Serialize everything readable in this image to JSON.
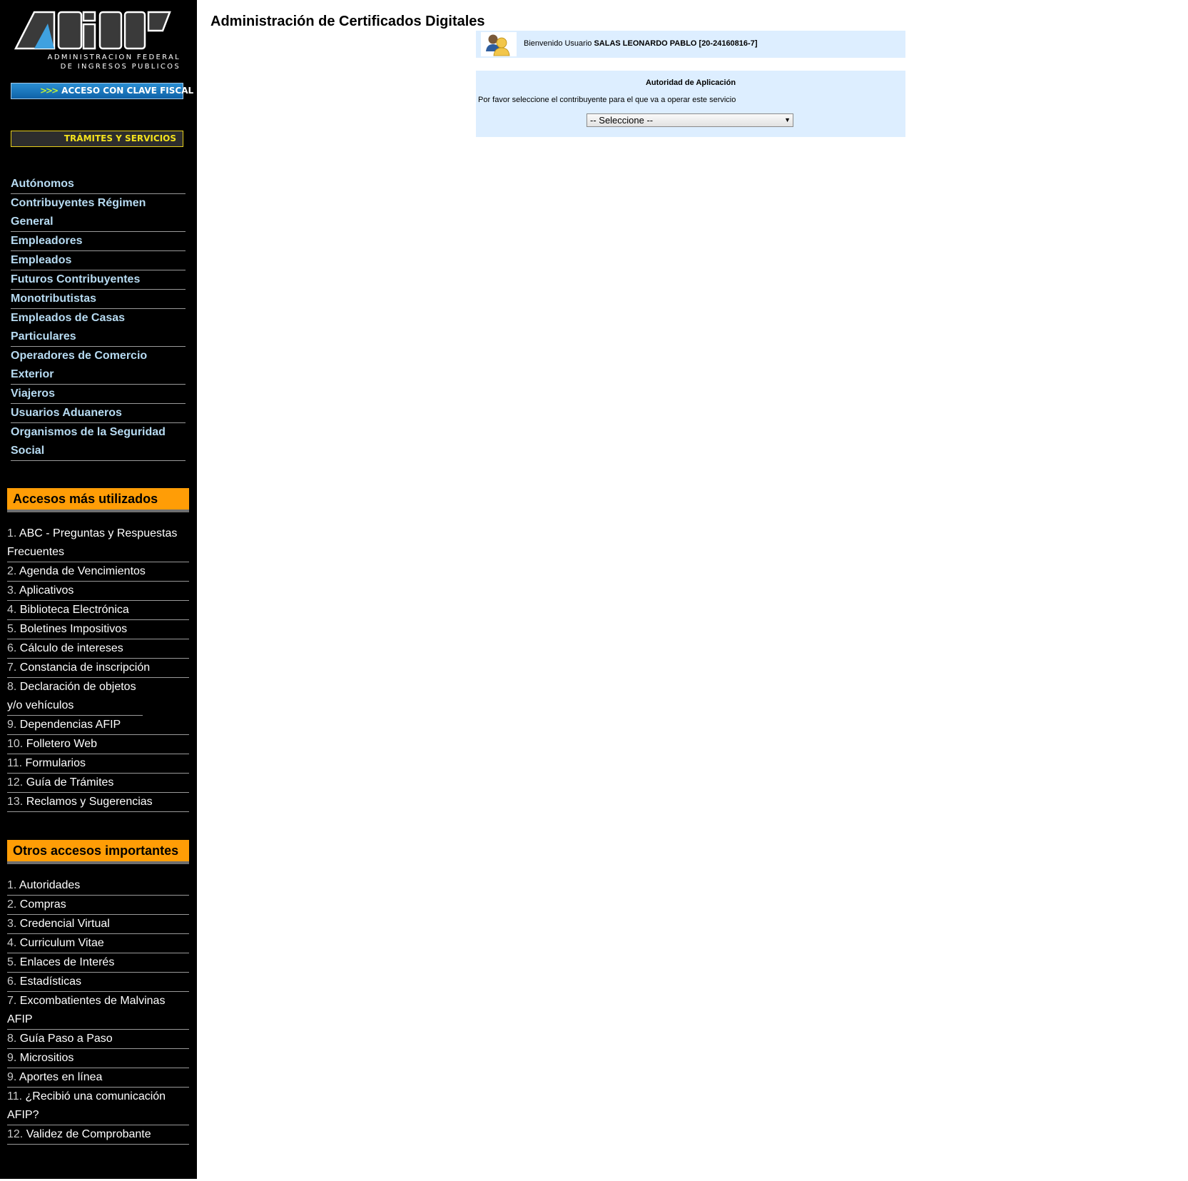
{
  "brand": {
    "logo_text": "AFIP",
    "subtitle_line1": "ADMINISTRACION FEDERAL",
    "subtitle_line2": "DE INGRESOS PUBLICOS"
  },
  "sidebar": {
    "clave_fiscal_label": "ACCESO CON CLAVE FISCAL",
    "clave_fiscal_chevrons": ">>>",
    "tramites_label": "TRÁMITES Y SERVICIOS",
    "nav": [
      "Autónomos",
      "Contribuyentes Régimen General",
      "Empleadores",
      "Empleados",
      "Futuros Contribuyentes",
      "Monotributistas",
      "Empleados de Casas Particulares",
      "Operadores de Comercio Exterior",
      "Viajeros",
      "Usuarios Aduaneros",
      "Organismos de la Seguridad Social"
    ],
    "accesos_title": "Accesos más utilizados",
    "accesos": [
      {
        "num": "1.",
        "label": "ABC - Preguntas y Respuestas Frecuentes"
      },
      {
        "num": "2.",
        "label": "Agenda de Vencimientos"
      },
      {
        "num": "3.",
        "label": "Aplicativos"
      },
      {
        "num": "4.",
        "label": "Biblioteca Electrónica"
      },
      {
        "num": "5.",
        "label": "Boletines Impositivos"
      },
      {
        "num": "6.",
        "label": "Cálculo de intereses"
      },
      {
        "num": "7.",
        "label": "Constancia de inscripción"
      },
      {
        "num": "8.",
        "label": "Declaración de objetos y/o vehículos"
      },
      {
        "num": "9.",
        "label": "Dependencias AFIP"
      },
      {
        "num": "10.",
        "label": "Folletero Web"
      },
      {
        "num": "11.",
        "label": "Formularios"
      },
      {
        "num": "12.",
        "label": "Guía de Trámites"
      },
      {
        "num": "13.",
        "label": "Reclamos y Sugerencias"
      }
    ],
    "otros_title": "Otros accesos importantes",
    "otros": [
      {
        "num": "1.",
        "label": "Autoridades"
      },
      {
        "num": "2.",
        "label": "Compras"
      },
      {
        "num": "3.",
        "label": "Credencial Virtual"
      },
      {
        "num": "4.",
        "label": "Curriculum Vitae"
      },
      {
        "num": "5.",
        "label": "Enlaces de Interés"
      },
      {
        "num": "6.",
        "label": "Estadísticas"
      },
      {
        "num": "7.",
        "label": "Excombatientes de Malvinas AFIP"
      },
      {
        "num": "8.",
        "label": "Guía Paso a Paso"
      },
      {
        "num": "9.",
        "label": "Micrositios"
      },
      {
        "num": "9.",
        "label": "Aportes en línea"
      },
      {
        "num": "11.",
        "label": "¿Recibió una comunicación AFIP?"
      },
      {
        "num": "12.",
        "label": "Validez de Comprobante"
      }
    ]
  },
  "main": {
    "title": "Administración de Certificados Digitales",
    "welcome_prefix": "Bienvenido Usuario",
    "user_name": "SALAS LEONARDO PABLO [20-24160816-7]",
    "authority_title": "Autoridad de Aplicación",
    "instruction": "Por favor seleccione el contribuyente para el que va a operar este servicio",
    "select_value": "-- Seleccione --",
    "select_arrow": "▼"
  },
  "colors": {
    "sidebar_bg": "#000000",
    "nav_link": "#b7dbf2",
    "section_header": "#ff9d06",
    "panel_bg": "#ddeeff",
    "clave_button": "#1a74bd",
    "tramites_border": "#e7cf1a"
  },
  "icons": {
    "user": "users-icon"
  }
}
